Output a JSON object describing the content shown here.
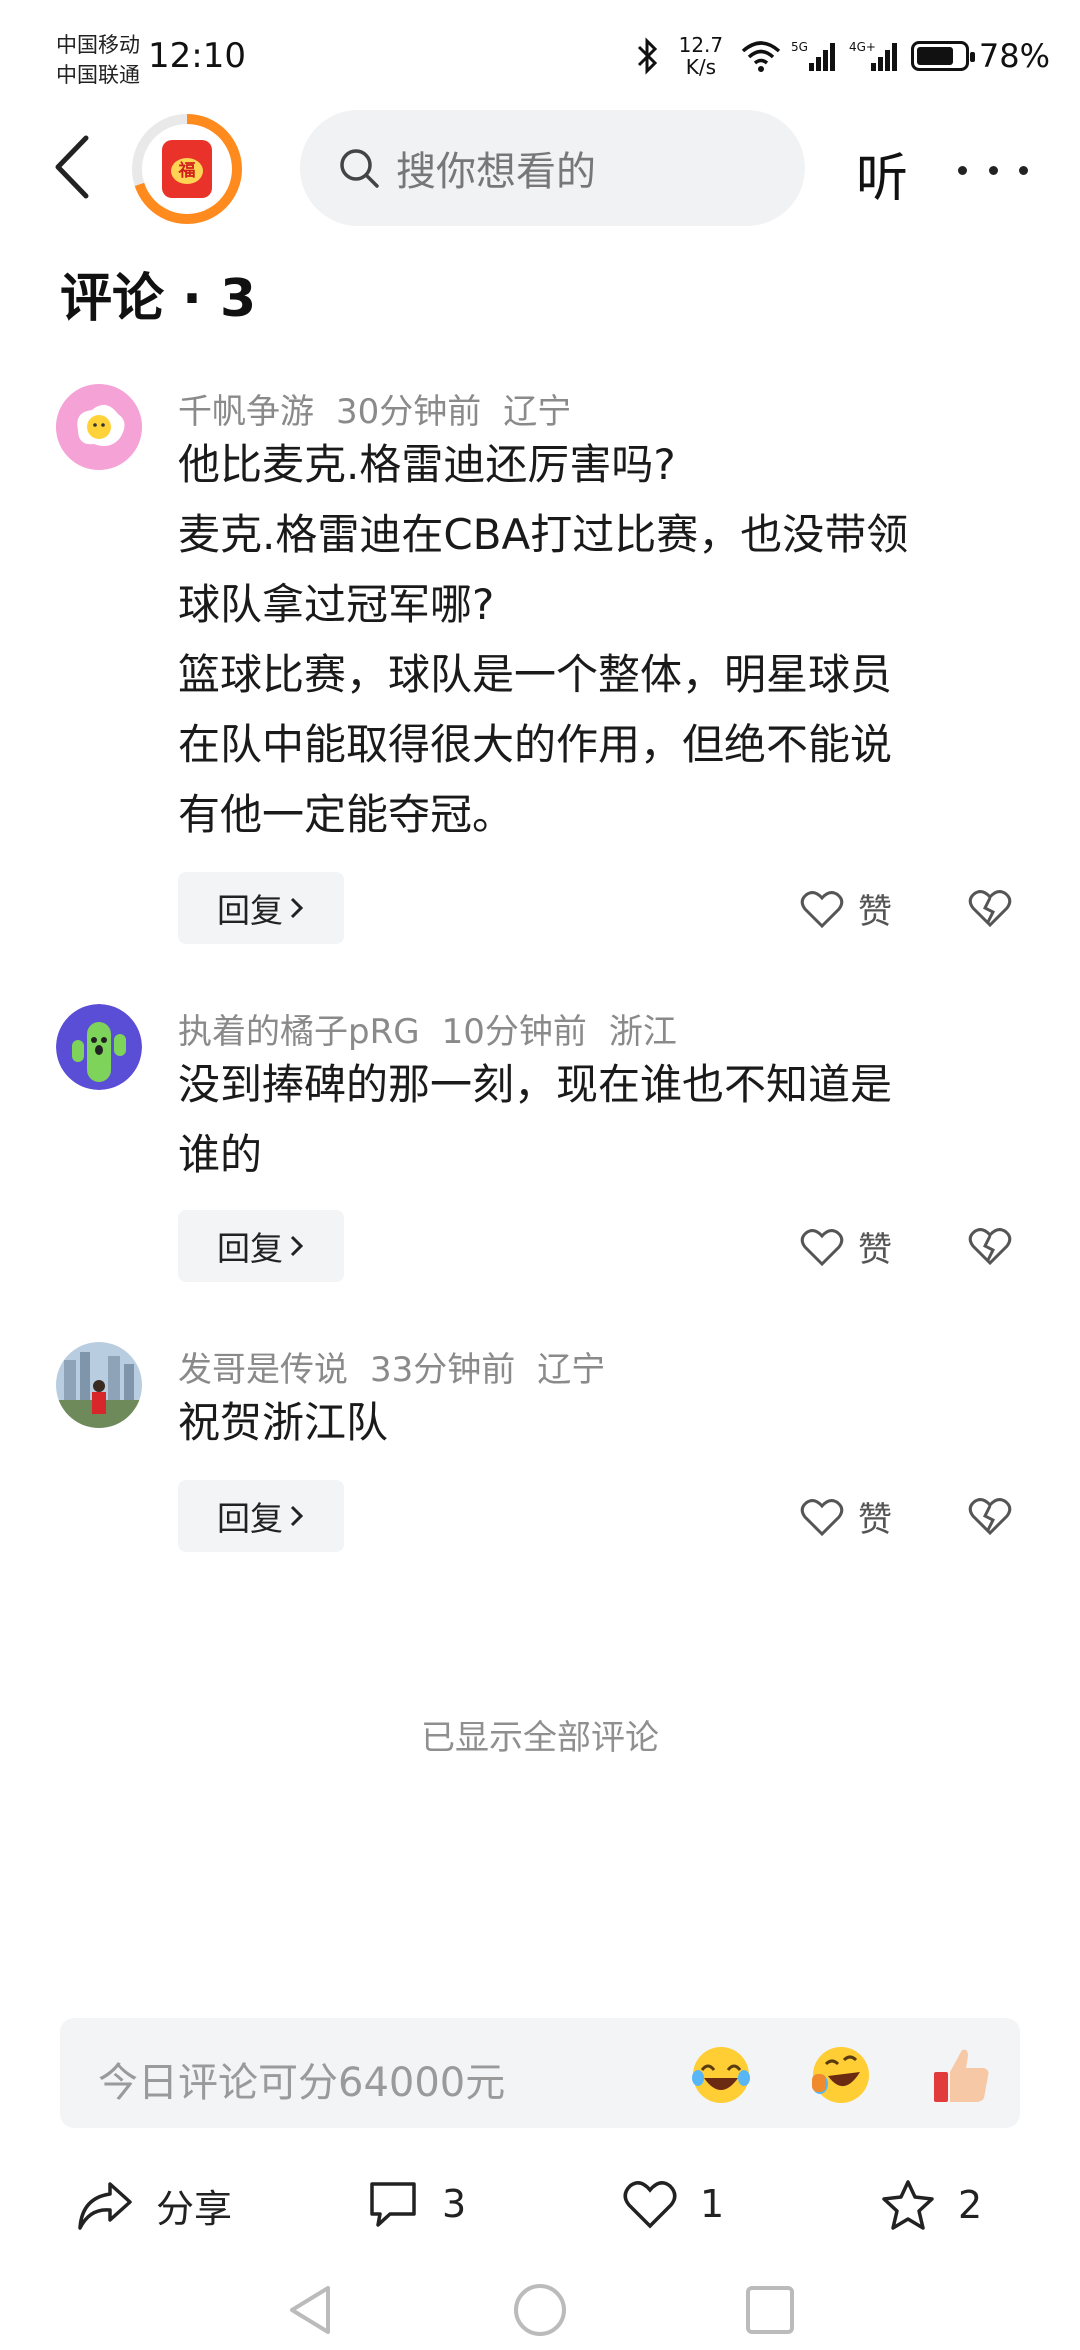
{
  "status_bar": {
    "carrier_1": "中国移动",
    "carrier_2": "中国联通",
    "time": "12:10",
    "net_speed_value": "12.7",
    "net_speed_unit": "K/s",
    "battery_percent": "78%",
    "battery_level": 0.78
  },
  "top_nav": {
    "search_placeholder": "搜你想看的",
    "listen_label": "听",
    "badge_glyph": "福",
    "badge_progress": 0.7
  },
  "comments_header": {
    "title": "评论 · 3"
  },
  "comments": [
    {
      "user": "千帆争游",
      "time": "30分钟前",
      "location": "辽宁",
      "lines": [
        "他比麦克.格雷迪还厉害吗?",
        "麦克.格雷迪在CBA打过比赛，也没带领",
        "球队拿过冠军哪?",
        "篮球比赛，球队是一个整体，明星球员",
        "在队中能取得很大的作用，但绝不能说",
        "有他一定能夺冠。"
      ],
      "reply_label": "回复",
      "like_label": "赞"
    },
    {
      "user": "执着的橘子pRG",
      "time": "10分钟前",
      "location": "浙江",
      "lines": [
        "没到捧碑的那一刻，现在谁也不知道是",
        "谁的"
      ],
      "reply_label": "回复",
      "like_label": "赞"
    },
    {
      "user": "发哥是传说",
      "time": "33分钟前",
      "location": "辽宁",
      "lines": [
        "祝贺浙江队"
      ],
      "reply_label": "回复",
      "like_label": "赞"
    }
  ],
  "footer_note": "已显示全部评论",
  "input_bar": {
    "placeholder": "今日评论可分64000元",
    "emojis": [
      "laughing-tears-emoji",
      "rolling-laugh-emoji",
      "thumbs-up-emoji"
    ]
  },
  "action_bar": {
    "share_label": "分享",
    "comment_count": "3",
    "like_count": "1",
    "favorite_count": "2"
  },
  "colors": {
    "accent_orange": "#ff8a1e",
    "red_packet": "#e8322a",
    "muted_text": "#8a8a8a"
  }
}
